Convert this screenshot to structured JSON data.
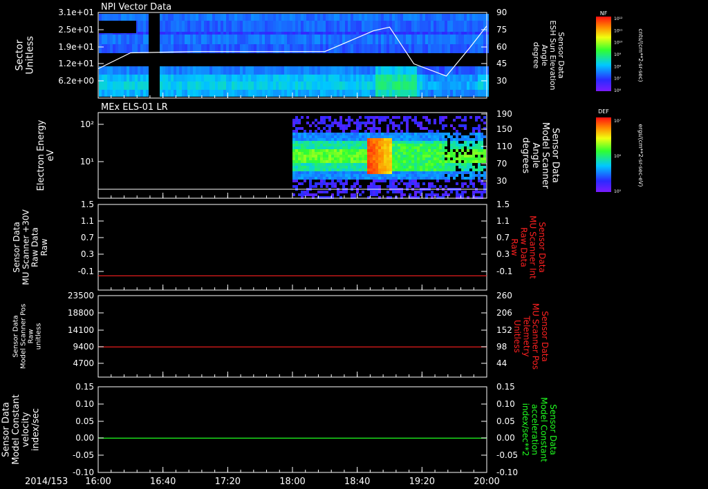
{
  "date_label": "2014/153",
  "time_ticks": [
    "16:00",
    "16:40",
    "17:20",
    "18:00",
    "18:40",
    "19:20",
    "20:00"
  ],
  "colors": {
    "background": "#000000",
    "axis": "#ffffff",
    "red_trace": "#ff2020",
    "green_trace": "#20ff20",
    "overlay_line": "#ffffff"
  },
  "panels": [
    {
      "id": "p1",
      "title": "NPI Vector Data",
      "left_label": [
        "Sector",
        "Unitless"
      ],
      "left_ticks": [
        "3.1e+01",
        "2.5e+01",
        "1.9e+01",
        "1.2e+01",
        "6.2e+00"
      ],
      "right_label": [
        "Sensor Data",
        "ESH Sun Elevation",
        "Angle",
        "degree"
      ],
      "right_ticks": [
        "90",
        "75",
        "60",
        "45",
        "30"
      ],
      "colorbar": {
        "title": "NF",
        "ticks": [
          "10¹²",
          "10¹¹",
          "10¹⁰",
          "10⁹",
          "10⁸",
          "10⁷",
          "10⁶"
        ],
        "label": "cnts/(cm**2-sr-sec)"
      }
    },
    {
      "id": "p2",
      "title": "MEx ELS-01 LR",
      "left_label": [
        "Electron Energy",
        "eV"
      ],
      "left_ticks": [
        "10²",
        "10¹"
      ],
      "right_label": [
        "Sensor Data",
        "Model Scanner",
        "Angle",
        "degrees"
      ],
      "right_ticks": [
        "190",
        "150",
        "110",
        "70",
        "30"
      ],
      "colorbar": {
        "title": "DEF",
        "ticks": [
          "10⁷",
          "10⁶",
          "10⁵"
        ],
        "label": "ergs/(cm**2-sr-sec-eV)"
      }
    },
    {
      "id": "p3",
      "left_label": [
        "Sensor Data",
        "MU Scanner +30V",
        "Raw Data",
        "Raw"
      ],
      "left_ticks": [
        "1.5",
        "1.1",
        "0.7",
        "0.3",
        "-0.1"
      ],
      "right_label": [
        "Sensor Data",
        "MU Scanner Int",
        "Raw Data",
        "Raw"
      ],
      "right_ticks": [
        "1.5",
        "1.1",
        "0.7",
        "0.3",
        "-0.1"
      ]
    },
    {
      "id": "p4",
      "left_label": [
        "Sensor Data",
        "Model Scanner Pos",
        "Raw",
        "unitless"
      ],
      "left_ticks": [
        "23500",
        "18800",
        "14100",
        "9400",
        "4700"
      ],
      "right_label": [
        "Sensor Data",
        "MU Scanner Pos",
        "Telemetry",
        "Unitless"
      ],
      "right_ticks": [
        "260",
        "206",
        "152",
        "98",
        "44"
      ]
    },
    {
      "id": "p5",
      "left_label": [
        "Sensor Data",
        "Model Constant",
        "velocity",
        "index/sec"
      ],
      "left_ticks": [
        "0.15",
        "0.10",
        "0.05",
        "0.00",
        "-0.05",
        "-0.10"
      ],
      "right_label": [
        "Sensor Data",
        "Model Constant",
        "acceleration",
        "index/sec**2"
      ],
      "right_ticks": [
        "0.15",
        "0.10",
        "0.05",
        "0.00",
        "-0.05",
        "-0.10"
      ]
    }
  ],
  "chart_data": [
    {
      "type": "heatmap",
      "title": "NPI Vector Data",
      "x_range": [
        "16:00",
        "20:00"
      ],
      "ylabel": "Sector Unitless",
      "y_ticks": [
        31,
        25,
        19,
        12,
        6.2
      ],
      "data_gap": [
        "16:30",
        "16:38"
      ],
      "overlay_series": {
        "name": "Sensor Data ESH Sun Elevation Angle",
        "units": "degree",
        "ylim": [
          20,
          90
        ],
        "x": [
          "16:00",
          "16:20",
          "17:00",
          "17:40",
          "18:20",
          "18:50",
          "19:00",
          "19:15",
          "19:35",
          "19:50",
          "20:00"
        ],
        "values": [
          44,
          57,
          58,
          58,
          58,
          75,
          78,
          48,
          38,
          62,
          79
        ]
      }
    },
    {
      "type": "heatmap",
      "title": "MEx ELS-01 LR",
      "x_range": [
        "16:00",
        "20:00"
      ],
      "ylabel": "Electron Energy eV",
      "ylim_log": [
        1,
        150
      ],
      "data_start": "18:00",
      "peak_interval": [
        "18:45",
        "19:00"
      ],
      "overlay_series": {
        "name": "Sensor Data Model Scanner Angle",
        "units": "degrees",
        "ylim": [
          10,
          190
        ],
        "values_constant": 12
      }
    },
    {
      "type": "line",
      "series": [
        {
          "name": "Sensor Data MU Scanner +30V Raw Data",
          "color": "#ff2020",
          "x": [
            "16:00",
            "20:00"
          ],
          "values": [
            0.0,
            0.0
          ]
        }
      ],
      "ylim": [
        -0.3,
        1.5
      ]
    },
    {
      "type": "line",
      "series": [
        {
          "name": "Sensor Data Model Scanner Pos Raw",
          "color": "#ff2020",
          "x": [
            "16:00",
            "20:00"
          ],
          "values": [
            8700,
            8700
          ]
        }
      ],
      "ylim": [
        0,
        23500
      ]
    },
    {
      "type": "line",
      "series": [
        {
          "name": "Sensor Data Model Constant velocity",
          "color": "#20ff20",
          "x": [
            "16:00",
            "20:00"
          ],
          "values": [
            0.0,
            0.0
          ]
        }
      ],
      "ylim": [
        -0.1,
        0.15
      ]
    }
  ]
}
